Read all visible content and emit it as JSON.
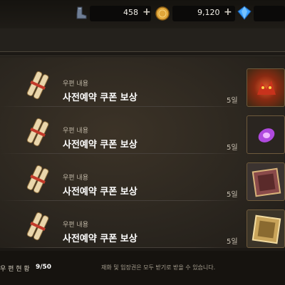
{
  "currency": [
    {
      "name": "boot-token",
      "value": "458",
      "plus": "+"
    },
    {
      "name": "gold-coin",
      "value": "9,120",
      "plus": "+"
    },
    {
      "name": "blue-gem",
      "value": "",
      "plus": ""
    }
  ],
  "mail": {
    "items": [
      {
        "label": "우편 내용",
        "title": "사전예약 쿠폰 보상",
        "days": "5일",
        "reward_icon": "red-beast-reward-icon"
      },
      {
        "label": "우편 내용",
        "title": "사전예약 쿠폰 보상",
        "days": "5일",
        "reward_icon": "purple-orb-reward-icon"
      },
      {
        "label": "우편 내용",
        "title": "사전예약 쿠폰 보상",
        "days": "5일",
        "reward_icon": "purple-card-reward-icon"
      },
      {
        "label": "우편 내용",
        "title": "사전예약 쿠폰 보상",
        "days": "5일",
        "reward_icon": "gold-card-reward-icon"
      }
    ]
  },
  "footer": {
    "status_label": "우 편 현 황",
    "count": "9/50",
    "notice": "재화 및 입장권은 모두 받기로 받을 수 있습니다."
  },
  "colors": {
    "accent": "#e0a63a",
    "gem": "#3aa0ff",
    "panel": "#2b261f"
  }
}
